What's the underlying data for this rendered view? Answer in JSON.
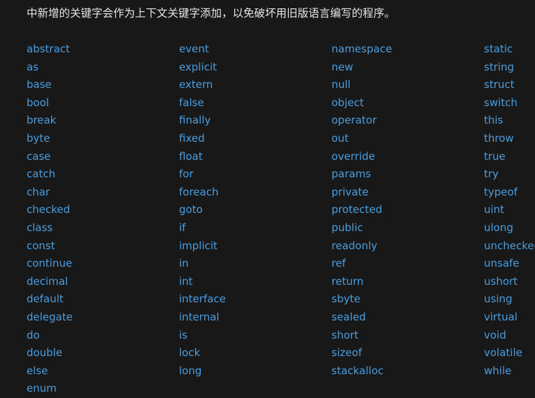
{
  "intro_text": "中新增的关键字会作为上下文关键字添加，以免破坏用旧版语言编写的程序。",
  "keyword_columns": [
    [
      "abstract",
      "as",
      "base",
      "bool",
      "break",
      "byte",
      "case",
      "catch",
      "char",
      "checked",
      "class",
      "const",
      "continue",
      "decimal",
      "default",
      "delegate",
      "do",
      "double",
      "else",
      "enum"
    ],
    [
      "event",
      "explicit",
      "extern",
      "false",
      "finally",
      "fixed",
      "float",
      "for",
      "foreach",
      "goto",
      "if",
      "implicit",
      "in",
      "int",
      "interface",
      "internal",
      "is",
      "lock",
      "long"
    ],
    [
      "namespace",
      "new",
      "null",
      "object",
      "operator",
      "out",
      "override",
      "params",
      "private",
      "protected",
      "public",
      "readonly",
      "ref",
      "return",
      "sbyte",
      "sealed",
      "short",
      "sizeof",
      "stackalloc"
    ],
    [
      "static",
      "string",
      "struct",
      "switch",
      "this",
      "throw",
      "true",
      "try",
      "typeof",
      "uint",
      "ulong",
      "unchecked",
      "unsafe",
      "ushort",
      "using",
      "virtual",
      "void",
      "volatile",
      "while"
    ]
  ],
  "colors": {
    "background": "#181818",
    "text": "#e6e6e6",
    "link": "#4a9ee0"
  }
}
